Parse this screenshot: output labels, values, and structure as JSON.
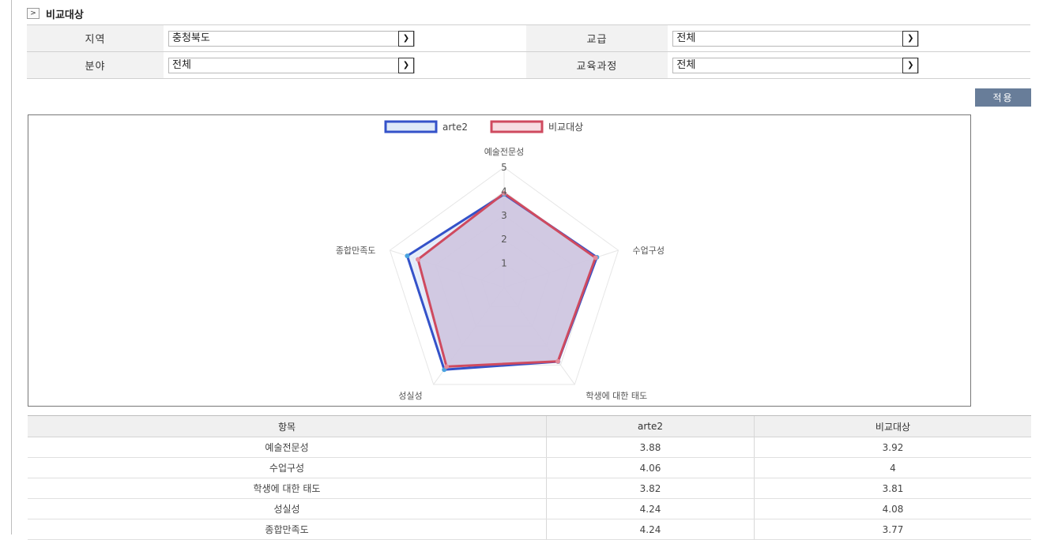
{
  "section": {
    "title": "비교대상",
    "arrow": ">"
  },
  "filters": {
    "region_label": "지역",
    "region_value": "충청북도",
    "grade_label": "교급",
    "grade_value": "전체",
    "field_label": "분야",
    "field_value": "전체",
    "course_label": "교육과정",
    "course_value": "전체"
  },
  "apply_label": "적용",
  "colors": {
    "series1": "#3452c9",
    "series1_fill": "#dde8f8",
    "series2": "#cf4a5f",
    "series2_fill": "#f7dde2",
    "grid": "#e6e6e6"
  },
  "chart_data": {
    "type": "radar",
    "categories": [
      "예술전문성",
      "수업구성",
      "학생에 대한 태도",
      "성실성",
      "종합만족도"
    ],
    "ticks": [
      1,
      2,
      3,
      4,
      5
    ],
    "range": [
      0,
      5
    ],
    "legend_position": "top",
    "series": [
      {
        "name": "arte2",
        "values": [
          3.88,
          4.06,
          3.82,
          4.24,
          4.24
        ]
      },
      {
        "name": "비교대상",
        "values": [
          3.92,
          4,
          3.81,
          4.08,
          3.77
        ]
      }
    ]
  },
  "table": {
    "headers": [
      "항목",
      "arte2",
      "비교대상"
    ],
    "rows": [
      [
        "예술전문성",
        "3.88",
        "3.92"
      ],
      [
        "수업구성",
        "4.06",
        "4"
      ],
      [
        "학생에 대한 태도",
        "3.82",
        "3.81"
      ],
      [
        "성실성",
        "4.24",
        "4.08"
      ],
      [
        "종합만족도",
        "4.24",
        "3.77"
      ]
    ]
  }
}
